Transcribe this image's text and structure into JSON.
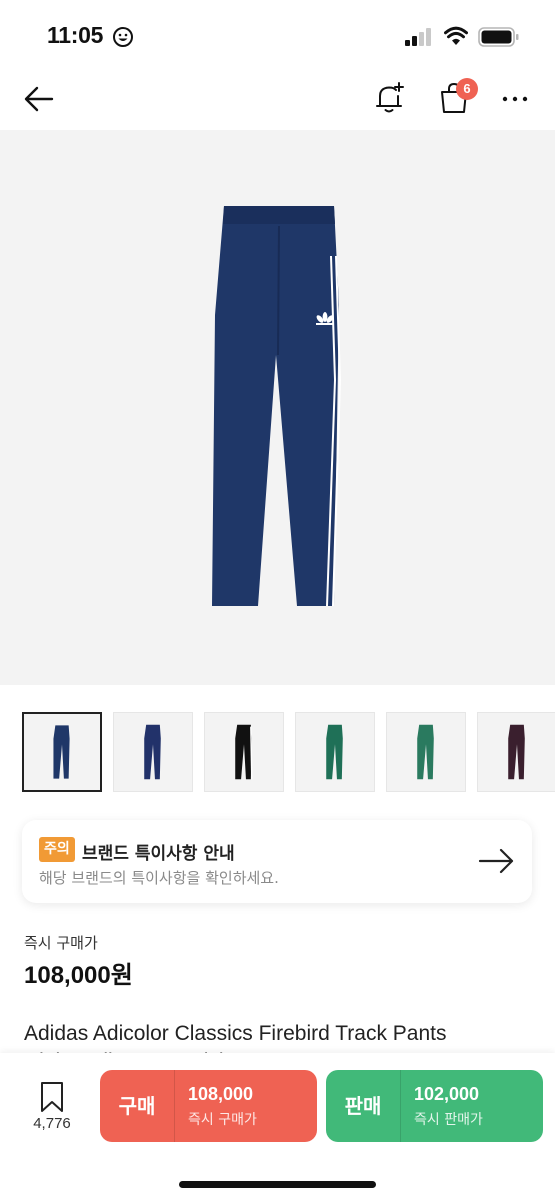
{
  "status_bar": {
    "time": "11:05",
    "emoji_icon": "smiley-face-icon",
    "signal_icon": "cellular-signal-icon",
    "wifi_icon": "wifi-icon",
    "battery_icon": "battery-icon"
  },
  "nav": {
    "back_icon": "back-arrow-icon",
    "bell_icon": "notification-bell-plus-icon",
    "cart_icon": "shopping-bag-icon",
    "cart_count": "6",
    "more_icon": "more-dots-icon"
  },
  "product_image": {
    "colors": {
      "pants": "#1f3768",
      "stripe": "#ffffff",
      "background": "#f3f3f3"
    }
  },
  "thumbnails": [
    {
      "color": "#1f3768",
      "selected": true
    },
    {
      "color": "#22326a",
      "selected": false
    },
    {
      "color": "#111111",
      "selected": false
    },
    {
      "color": "#1f7057",
      "selected": false
    },
    {
      "color": "#2a7a5f",
      "selected": false
    },
    {
      "color": "#3a1f2e",
      "selected": false
    }
  ],
  "notice": {
    "badge": "주의",
    "title": "브랜드 특이사항 안내",
    "description": "해당 브랜드의 특이사항을 확인하세요.",
    "arrow_icon": "arrow-right-icon"
  },
  "price": {
    "label": "즉시 구매가",
    "value": "108,000원"
  },
  "product": {
    "title": "Adidas Adicolor Classics Firebird Track Pants",
    "subtitle": "Night Indigo - US Sizing"
  },
  "bottom_bar": {
    "wish_icon": "bookmark-icon",
    "wish_count": "4,776",
    "buy": {
      "label": "구매",
      "price": "108,000",
      "sub": "즉시 구매가",
      "color": "#ef6253"
    },
    "sell": {
      "label": "판매",
      "price": "102,000",
      "sub": "즉시 판매가",
      "color": "#41b979"
    }
  }
}
